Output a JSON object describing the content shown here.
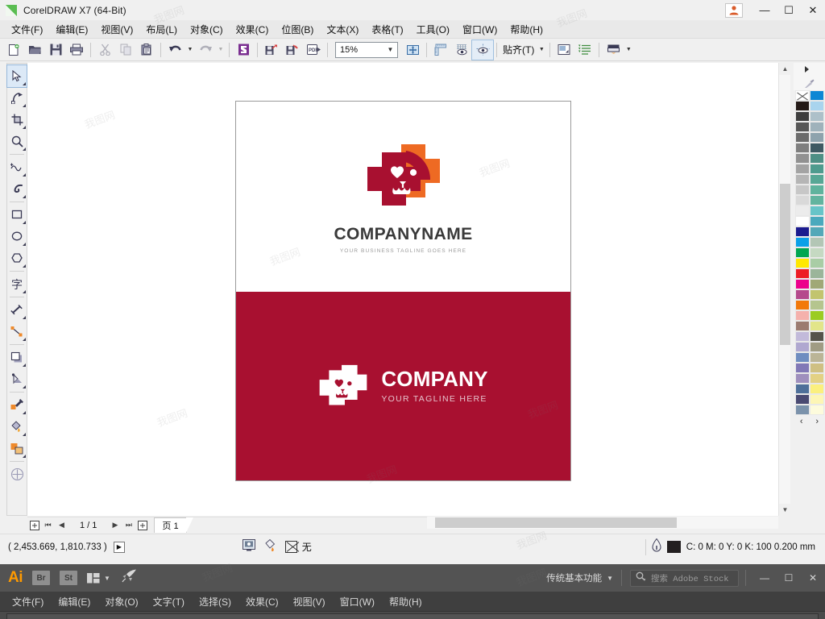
{
  "titlebar": {
    "app_title": "CorelDRAW X7 (64-Bit)",
    "account_icon": "user-account-icon",
    "minimize": "—",
    "maximize": "☐",
    "close": "✕"
  },
  "menubar": {
    "items": [
      {
        "label": "文件(F)"
      },
      {
        "label": "编辑(E)"
      },
      {
        "label": "视图(V)"
      },
      {
        "label": "布局(L)"
      },
      {
        "label": "对象(C)"
      },
      {
        "label": "效果(C)"
      },
      {
        "label": "位图(B)"
      },
      {
        "label": "文本(X)"
      },
      {
        "label": "表格(T)"
      },
      {
        "label": "工具(O)"
      },
      {
        "label": "窗口(W)"
      },
      {
        "label": "帮助(H)"
      }
    ]
  },
  "toolbar": {
    "zoom_level": "15%",
    "snap_label": "贴齐(T)",
    "buttons": [
      {
        "name": "new-document-icon"
      },
      {
        "name": "open-document-icon"
      },
      {
        "name": "save-icon"
      },
      {
        "name": "print-icon"
      },
      {
        "name": "cut-icon"
      },
      {
        "name": "copy-icon"
      },
      {
        "name": "paste-icon"
      },
      {
        "name": "undo-icon"
      },
      {
        "name": "redo-icon"
      },
      {
        "name": "corel-connect-icon"
      },
      {
        "name": "import-icon"
      },
      {
        "name": "export-icon"
      },
      {
        "name": "publish-pdf-icon"
      },
      {
        "name": "zoom-levels-combo"
      },
      {
        "name": "full-screen-preview-icon"
      },
      {
        "name": "show-rulers-icon"
      },
      {
        "name": "show-grid-icon"
      },
      {
        "name": "show-guides-icon"
      },
      {
        "name": "snap-to-dropdown"
      },
      {
        "name": "options-icon"
      },
      {
        "name": "object-manager-icon"
      },
      {
        "name": "application-launcher-icon"
      }
    ]
  },
  "toolbox": {
    "tools": [
      {
        "name": "pick-tool",
        "selected": true
      },
      {
        "name": "shape-tool",
        "selected": false
      },
      {
        "name": "crop-tool",
        "selected": false
      },
      {
        "name": "zoom-tool",
        "selected": false
      },
      {
        "name": "freehand-tool",
        "selected": false
      },
      {
        "name": "artistic-media-tool",
        "selected": false
      },
      {
        "name": "rectangle-tool",
        "selected": false
      },
      {
        "name": "ellipse-tool",
        "selected": false
      },
      {
        "name": "polygon-tool",
        "selected": false
      },
      {
        "name": "text-tool",
        "selected": false
      },
      {
        "name": "parallel-dimension-tool",
        "selected": false
      },
      {
        "name": "straight-line-connector-tool",
        "selected": false
      },
      {
        "name": "drop-shadow-tool",
        "selected": false
      },
      {
        "name": "transparency-tool",
        "selected": false
      },
      {
        "name": "color-eyedropper-tool",
        "selected": false
      },
      {
        "name": "interactive-fill-tool",
        "selected": false
      },
      {
        "name": "smart-fill-tool",
        "selected": false
      },
      {
        "name": "outline-tool",
        "selected": false
      }
    ]
  },
  "canvas": {
    "logo_top": {
      "brand_name": "COMPANYNAME",
      "tagline": "YOUR BUSINESS TAGLINE GOES HERE",
      "mark_name": "pet-clinic-dog-cross-logo"
    },
    "logo_bottom": {
      "brand_name": "COMPANY",
      "tagline": "YOUR TAGLINE HERE",
      "mark_name": "pet-clinic-dog-cross-logo-white",
      "background_color": "#a81030"
    },
    "colors": {
      "dark_red": "#a81030",
      "orange": "#ee6a23",
      "white": "#ffffff",
      "heading_gray": "#3a3a3a",
      "tagline_gray": "#9a9a9a"
    }
  },
  "pagebar": {
    "add_page_start_icon": "add-page-icon",
    "first": "⏮",
    "prev": "◀",
    "page_count": "1 / 1",
    "next": "▶",
    "last": "⏭",
    "add_page_end_icon": "add-page-icon",
    "tab_label": "页 1"
  },
  "statusbar": {
    "coordinates": "( 2,453.669, 1,810.733 )",
    "fill_none_label": "无",
    "outline_color_hex": "#231f20",
    "outline_info": "C: 0 M: 0 Y: 0 K: 100  0.200 mm",
    "icons": [
      {
        "name": "document-properties-icon"
      },
      {
        "name": "fill-color-icon"
      },
      {
        "name": "no-fill-icon"
      },
      {
        "name": "outline-pen-icon"
      }
    ]
  },
  "palette": {
    "selected_swatch": "no-color",
    "nav_prev": "‹",
    "nav_next": "›",
    "swatches": [
      [
        "none",
        "#0d87d4"
      ],
      [
        "#241a17",
        "#a9d4ee"
      ],
      [
        "#3d3d3d",
        "#adc0c9"
      ],
      [
        "#565656",
        "#9fb2bb"
      ],
      [
        "#6b6b6b",
        "#8ea3ad"
      ],
      [
        "#7e7e7e",
        "#3f5a63"
      ],
      [
        "#919191",
        "#4e8f85"
      ],
      [
        "#a3a3a3",
        "#4e9b8e"
      ],
      [
        "#b5b5b5",
        "#57a795"
      ],
      [
        "#c7c7c7",
        "#5fb39d"
      ],
      [
        "#d9d9d9",
        "#62b49f"
      ],
      [
        "#ececec",
        "#67c4c8"
      ],
      [
        "#ffffff",
        "#4aa9bd"
      ],
      [
        "#1b1b8f",
        "#53a8b8"
      ],
      [
        "#0aa0e8",
        "#b3c6b5"
      ],
      [
        "#00a651",
        "#c5d9c2"
      ],
      [
        "#ffe800",
        "#a9cda5"
      ],
      [
        "#ed1c24",
        "#9bb59a"
      ],
      [
        "#ec008c",
        "#a0a877"
      ],
      [
        "#b54a8c",
        "#c2c46e"
      ],
      [
        "#f2790a",
        "#b5c58e"
      ],
      [
        "#f5b1ac",
        "#9bcc22"
      ],
      [
        "#9b7b70",
        "#e2e58a"
      ],
      [
        "#c2bada",
        "#55544a"
      ],
      [
        "#b0a8d0",
        "#a09c84"
      ],
      [
        "#6f8dc0",
        "#bbb597"
      ],
      [
        "#8178b6",
        "#cfc083"
      ],
      [
        "#9f8fbd",
        "#e3d184"
      ],
      [
        "#4e6f99",
        "#fbf07e"
      ],
      [
        "#4a4a72",
        "#fdf6b5"
      ],
      [
        "#7b92ab",
        "#fdfbdc"
      ]
    ]
  },
  "adobe_taskbar": {
    "app_logo": "Ai",
    "bridge_label": "Br",
    "stock_label": "St",
    "arrange_icon": "arrange-documents-icon",
    "rocket_icon": "rocket-icon",
    "workspace": "传统基本功能",
    "search_placeholder": "搜索 Adobe Stock",
    "search_icon": "search-icon",
    "minimize": "—",
    "maximize": "☐",
    "close": "✕",
    "menu": [
      {
        "label": "文件(F)"
      },
      {
        "label": "编辑(E)"
      },
      {
        "label": "对象(O)"
      },
      {
        "label": "文字(T)"
      },
      {
        "label": "选择(S)"
      },
      {
        "label": "效果(C)"
      },
      {
        "label": "视图(V)"
      },
      {
        "label": "窗口(W)"
      },
      {
        "label": "帮助(H)"
      }
    ]
  },
  "watermark": {
    "text": "我图网"
  }
}
